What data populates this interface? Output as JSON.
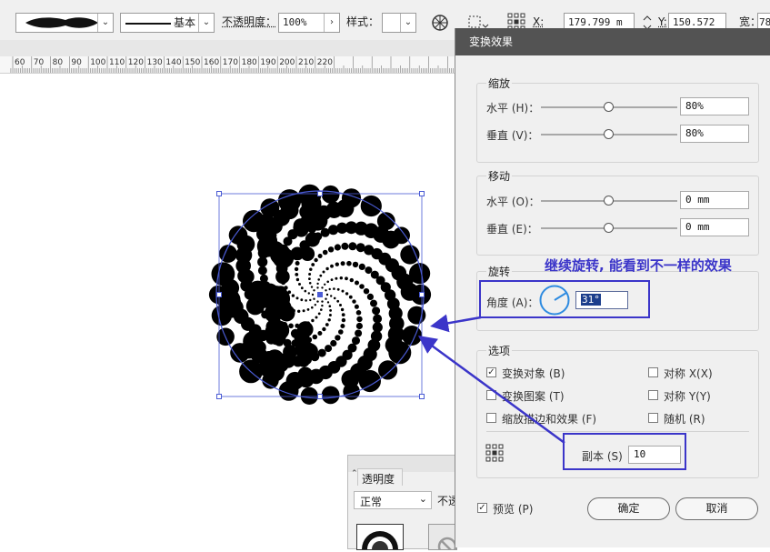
{
  "toolbar": {
    "stroke_style_label": "基本",
    "opacity_label": "不透明度：",
    "opacity_value": "100%",
    "style_label": "样式：",
    "x_label": "X:",
    "x_value": "179.799 m",
    "y_label": "Y:",
    "y_value": "150.572 m",
    "w_label": "宽：",
    "w_value": "78"
  },
  "ruler": {
    "ticks": [
      "60",
      "70",
      "80",
      "90",
      "100",
      "110",
      "120",
      "130",
      "140",
      "150",
      "160",
      "170",
      "180",
      "190",
      "200",
      "210",
      "220"
    ]
  },
  "dialog": {
    "title": "变换效果",
    "scale": {
      "title": "缩放",
      "horizontal_label": "水平 (H)：",
      "horizontal_value": "80%",
      "horizontal_level": 0.5,
      "vertical_label": "垂直 (V)：",
      "vertical_value": "80%",
      "vertical_level": 0.5
    },
    "move": {
      "title": "移动",
      "horizontal_label": "水平 (O)：",
      "horizontal_value": "0 mm",
      "horizontal_level": 0.5,
      "vertical_label": "垂直 (E)：",
      "vertical_value": "0 mm",
      "vertical_level": 0.5
    },
    "rotate": {
      "title": "旋转",
      "angle_label": "角度 (A)：",
      "angle_value": "31°"
    },
    "options": {
      "title": "选项",
      "transform_objects": "变换对象 (B)",
      "transform_objects_checked": true,
      "transform_patterns": "变换图案 (T)",
      "transform_patterns_checked": false,
      "scale_strokes": "缩放描边和效果 (F)",
      "scale_strokes_checked": false,
      "reflect_x": "对称 X(X)",
      "reflect_x_checked": false,
      "reflect_y": "对称 Y(Y)",
      "reflect_y_checked": false,
      "random": "随机 (R)",
      "random_checked": false,
      "copies_label": "副本 (S)",
      "copies_value": "10"
    },
    "preview_label": "预览 (P)",
    "preview_checked": true,
    "ok_label": "确定",
    "cancel_label": "取消"
  },
  "transparency_panel": {
    "title": "透明度",
    "blend_mode": "正常",
    "opacity_label": "不透"
  },
  "annotation": {
    "text": "继续旋转, 能看到不一样的效果",
    "color": "#3b35c9"
  }
}
